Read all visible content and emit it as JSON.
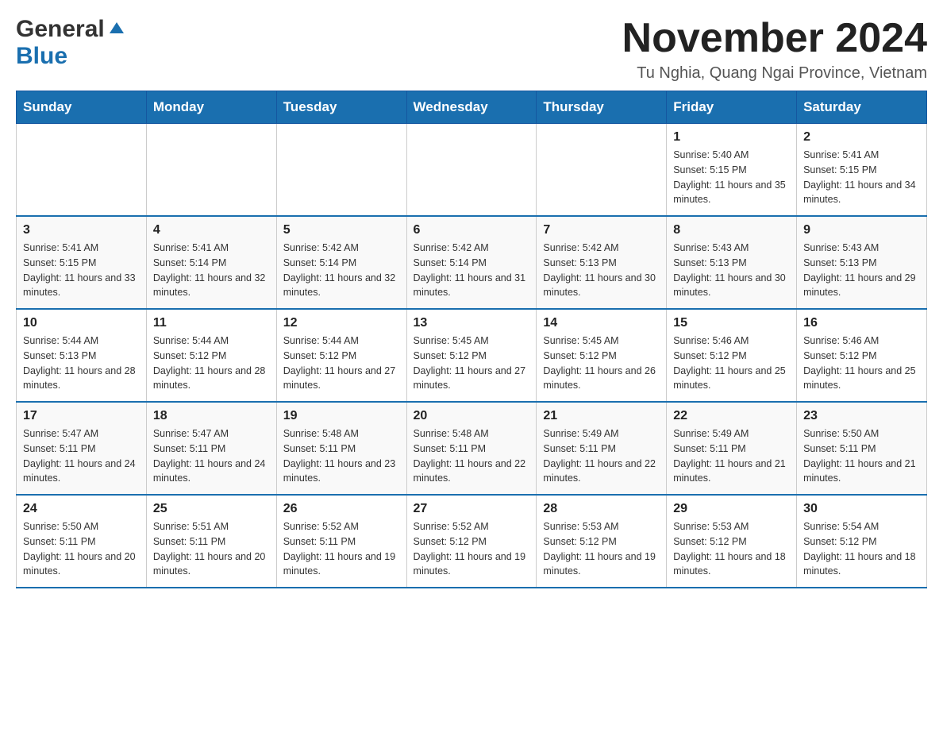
{
  "header": {
    "logo": {
      "general": "General",
      "blue": "Blue",
      "triangle_unicode": "▶"
    },
    "title": "November 2024",
    "location": "Tu Nghia, Quang Ngai Province, Vietnam"
  },
  "calendar": {
    "days_of_week": [
      "Sunday",
      "Monday",
      "Tuesday",
      "Wednesday",
      "Thursday",
      "Friday",
      "Saturday"
    ],
    "weeks": [
      [
        {
          "day": "",
          "info": ""
        },
        {
          "day": "",
          "info": ""
        },
        {
          "day": "",
          "info": ""
        },
        {
          "day": "",
          "info": ""
        },
        {
          "day": "",
          "info": ""
        },
        {
          "day": "1",
          "info": "Sunrise: 5:40 AM\nSunset: 5:15 PM\nDaylight: 11 hours and 35 minutes."
        },
        {
          "day": "2",
          "info": "Sunrise: 5:41 AM\nSunset: 5:15 PM\nDaylight: 11 hours and 34 minutes."
        }
      ],
      [
        {
          "day": "3",
          "info": "Sunrise: 5:41 AM\nSunset: 5:15 PM\nDaylight: 11 hours and 33 minutes."
        },
        {
          "day": "4",
          "info": "Sunrise: 5:41 AM\nSunset: 5:14 PM\nDaylight: 11 hours and 32 minutes."
        },
        {
          "day": "5",
          "info": "Sunrise: 5:42 AM\nSunset: 5:14 PM\nDaylight: 11 hours and 32 minutes."
        },
        {
          "day": "6",
          "info": "Sunrise: 5:42 AM\nSunset: 5:14 PM\nDaylight: 11 hours and 31 minutes."
        },
        {
          "day": "7",
          "info": "Sunrise: 5:42 AM\nSunset: 5:13 PM\nDaylight: 11 hours and 30 minutes."
        },
        {
          "day": "8",
          "info": "Sunrise: 5:43 AM\nSunset: 5:13 PM\nDaylight: 11 hours and 30 minutes."
        },
        {
          "day": "9",
          "info": "Sunrise: 5:43 AM\nSunset: 5:13 PM\nDaylight: 11 hours and 29 minutes."
        }
      ],
      [
        {
          "day": "10",
          "info": "Sunrise: 5:44 AM\nSunset: 5:13 PM\nDaylight: 11 hours and 28 minutes."
        },
        {
          "day": "11",
          "info": "Sunrise: 5:44 AM\nSunset: 5:12 PM\nDaylight: 11 hours and 28 minutes."
        },
        {
          "day": "12",
          "info": "Sunrise: 5:44 AM\nSunset: 5:12 PM\nDaylight: 11 hours and 27 minutes."
        },
        {
          "day": "13",
          "info": "Sunrise: 5:45 AM\nSunset: 5:12 PM\nDaylight: 11 hours and 27 minutes."
        },
        {
          "day": "14",
          "info": "Sunrise: 5:45 AM\nSunset: 5:12 PM\nDaylight: 11 hours and 26 minutes."
        },
        {
          "day": "15",
          "info": "Sunrise: 5:46 AM\nSunset: 5:12 PM\nDaylight: 11 hours and 25 minutes."
        },
        {
          "day": "16",
          "info": "Sunrise: 5:46 AM\nSunset: 5:12 PM\nDaylight: 11 hours and 25 minutes."
        }
      ],
      [
        {
          "day": "17",
          "info": "Sunrise: 5:47 AM\nSunset: 5:11 PM\nDaylight: 11 hours and 24 minutes."
        },
        {
          "day": "18",
          "info": "Sunrise: 5:47 AM\nSunset: 5:11 PM\nDaylight: 11 hours and 24 minutes."
        },
        {
          "day": "19",
          "info": "Sunrise: 5:48 AM\nSunset: 5:11 PM\nDaylight: 11 hours and 23 minutes."
        },
        {
          "day": "20",
          "info": "Sunrise: 5:48 AM\nSunset: 5:11 PM\nDaylight: 11 hours and 22 minutes."
        },
        {
          "day": "21",
          "info": "Sunrise: 5:49 AM\nSunset: 5:11 PM\nDaylight: 11 hours and 22 minutes."
        },
        {
          "day": "22",
          "info": "Sunrise: 5:49 AM\nSunset: 5:11 PM\nDaylight: 11 hours and 21 minutes."
        },
        {
          "day": "23",
          "info": "Sunrise: 5:50 AM\nSunset: 5:11 PM\nDaylight: 11 hours and 21 minutes."
        }
      ],
      [
        {
          "day": "24",
          "info": "Sunrise: 5:50 AM\nSunset: 5:11 PM\nDaylight: 11 hours and 20 minutes."
        },
        {
          "day": "25",
          "info": "Sunrise: 5:51 AM\nSunset: 5:11 PM\nDaylight: 11 hours and 20 minutes."
        },
        {
          "day": "26",
          "info": "Sunrise: 5:52 AM\nSunset: 5:11 PM\nDaylight: 11 hours and 19 minutes."
        },
        {
          "day": "27",
          "info": "Sunrise: 5:52 AM\nSunset: 5:12 PM\nDaylight: 11 hours and 19 minutes."
        },
        {
          "day": "28",
          "info": "Sunrise: 5:53 AM\nSunset: 5:12 PM\nDaylight: 11 hours and 19 minutes."
        },
        {
          "day": "29",
          "info": "Sunrise: 5:53 AM\nSunset: 5:12 PM\nDaylight: 11 hours and 18 minutes."
        },
        {
          "day": "30",
          "info": "Sunrise: 5:54 AM\nSunset: 5:12 PM\nDaylight: 11 hours and 18 minutes."
        }
      ]
    ]
  }
}
